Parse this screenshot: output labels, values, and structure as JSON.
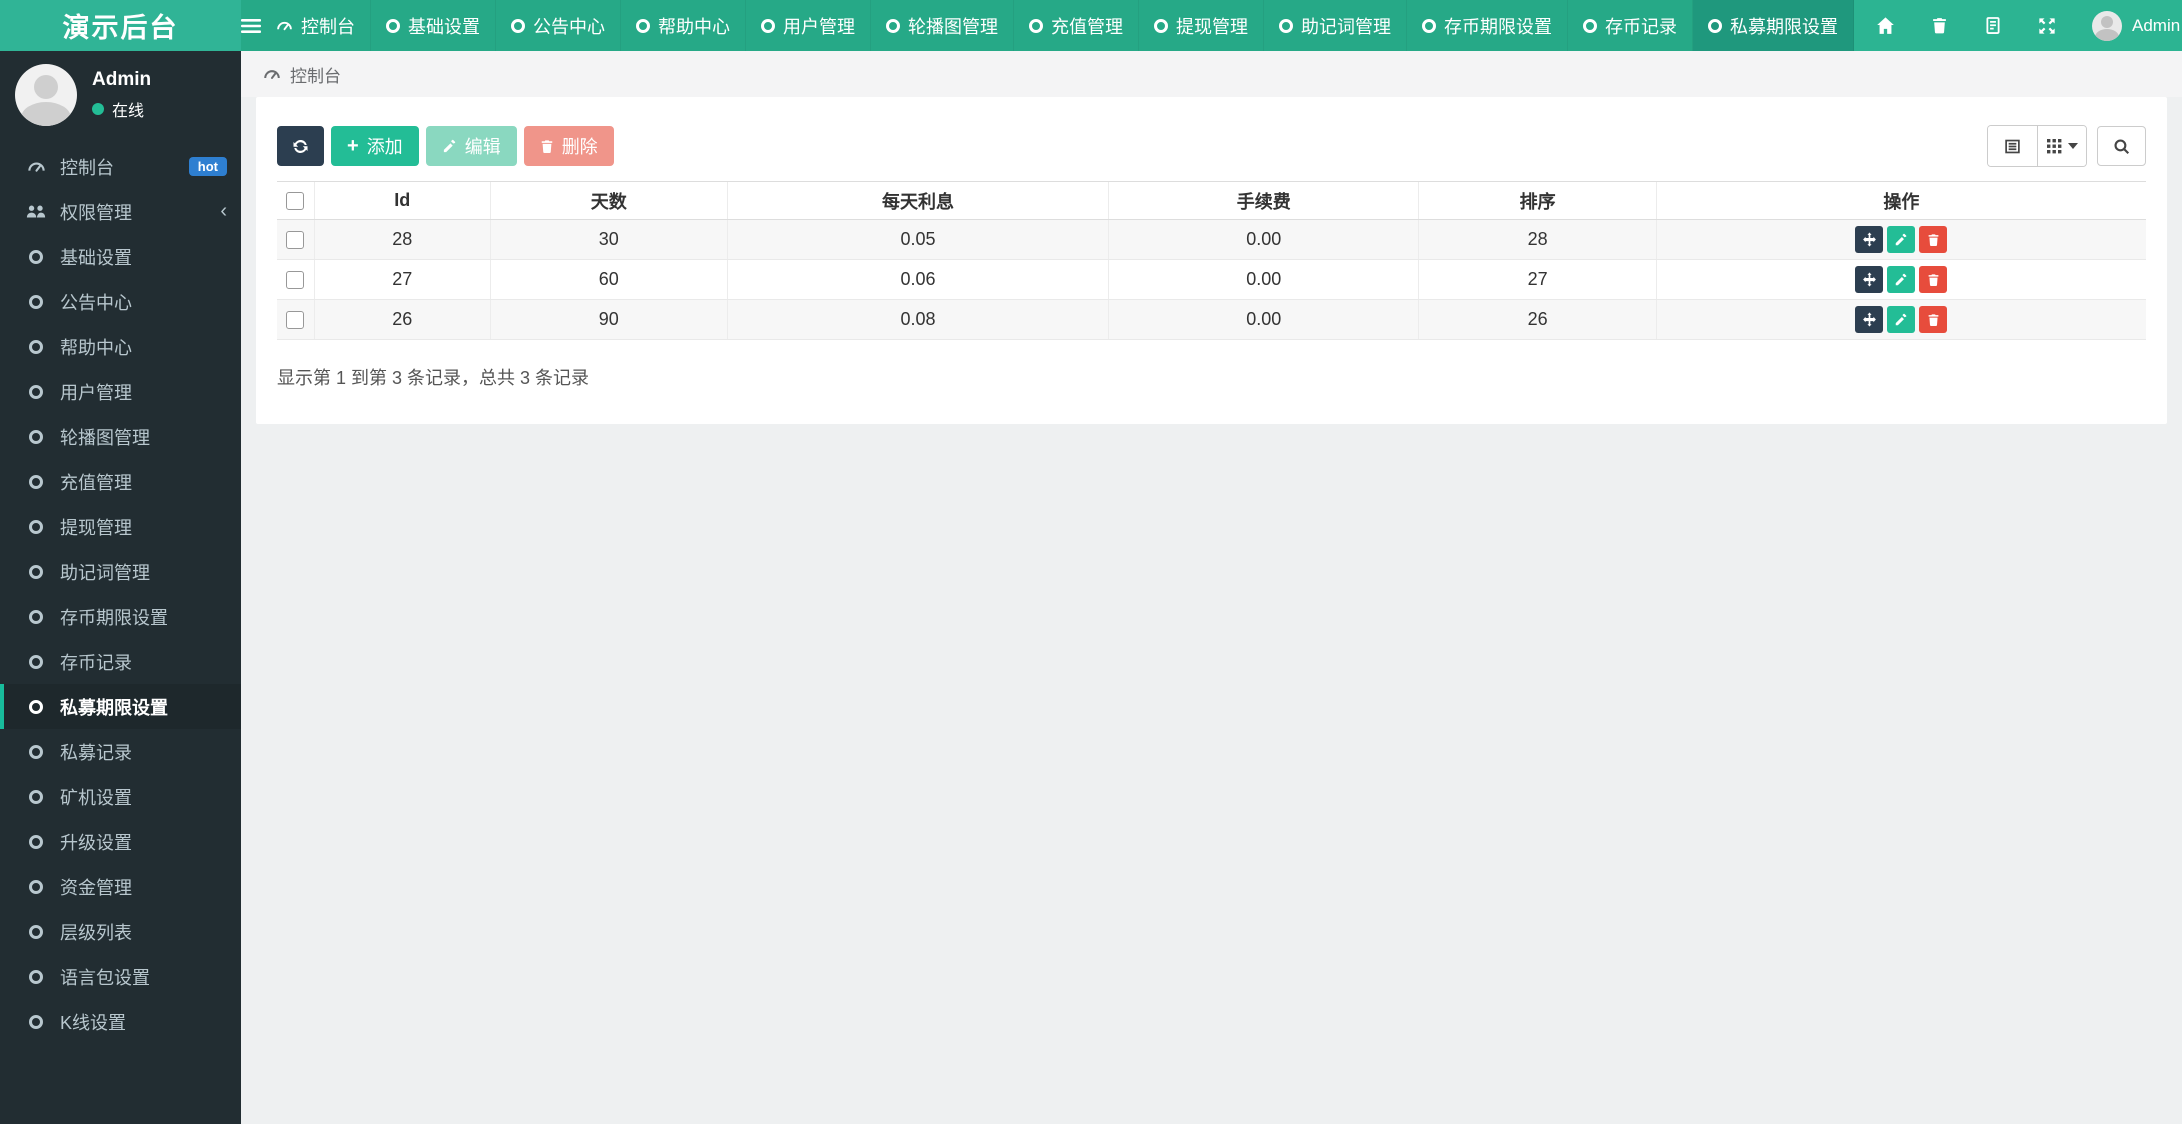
{
  "colors": {
    "brand_bg": "#30b496",
    "nav_bg": "#2cb492",
    "nav_tab_bg": "#26a987",
    "nav_tab_active_bg": "#1f987d",
    "sidebar_bg": "#222d32",
    "sidebar_text": "#b8c7ce",
    "sidebar_active_bg": "#1e282c",
    "accent": "#18bc9c",
    "primary_dark": "#2c3e50",
    "success": "#23bd96",
    "success_muted": "#8ad8c0",
    "danger": "#e74c3c",
    "danger_muted": "#f0958a",
    "hot_badge": "#2e7fd1",
    "page_bg": "#eef0f1",
    "strip_bg": "#f4f4f5",
    "card_bg": "#ffffff",
    "row_stripe": "#f7f7f7",
    "border": "#dddddd",
    "text": "#333333",
    "online_dot": "#23bd96"
  },
  "topbar": {
    "brand": "演示后台",
    "hamburger_icon": "menu-icon",
    "tabs": [
      {
        "label": "控制台",
        "icon": "gauge",
        "active": false
      },
      {
        "label": "基础设置",
        "icon": "circle",
        "active": false
      },
      {
        "label": "公告中心",
        "icon": "circle",
        "active": false
      },
      {
        "label": "帮助中心",
        "icon": "circle",
        "active": false
      },
      {
        "label": "用户管理",
        "icon": "circle",
        "active": false
      },
      {
        "label": "轮播图管理",
        "icon": "circle",
        "active": false
      },
      {
        "label": "充值管理",
        "icon": "circle",
        "active": false
      },
      {
        "label": "提现管理",
        "icon": "circle",
        "active": false
      },
      {
        "label": "助记词管理",
        "icon": "circle",
        "active": false
      },
      {
        "label": "存币期限设置",
        "icon": "circle",
        "active": false
      },
      {
        "label": "存币记录",
        "icon": "circle",
        "active": false
      },
      {
        "label": "私募期限设置",
        "icon": "circle",
        "active": true
      }
    ],
    "right_icons": [
      "home-icon",
      "trash-icon",
      "document-icon",
      "fullscreen-icon"
    ],
    "user_label": "Admin"
  },
  "sidebar": {
    "user": {
      "name": "Admin",
      "status": "在线"
    },
    "items": [
      {
        "label": "控制台",
        "icon": "gauge",
        "badge": "hot",
        "active": false
      },
      {
        "label": "权限管理",
        "icon": "users",
        "chevron": "‹",
        "active": false
      },
      {
        "label": "基础设置",
        "icon": "circle",
        "active": false
      },
      {
        "label": "公告中心",
        "icon": "circle",
        "active": false
      },
      {
        "label": "帮助中心",
        "icon": "circle",
        "active": false
      },
      {
        "label": "用户管理",
        "icon": "circle",
        "active": false
      },
      {
        "label": "轮播图管理",
        "icon": "circle",
        "active": false
      },
      {
        "label": "充值管理",
        "icon": "circle",
        "active": false
      },
      {
        "label": "提现管理",
        "icon": "circle",
        "active": false
      },
      {
        "label": "助记词管理",
        "icon": "circle",
        "active": false
      },
      {
        "label": "存币期限设置",
        "icon": "circle",
        "active": false
      },
      {
        "label": "存币记录",
        "icon": "circle",
        "active": false
      },
      {
        "label": "私募期限设置",
        "icon": "circle",
        "active": true
      },
      {
        "label": "私募记录",
        "icon": "circle",
        "active": false
      },
      {
        "label": "矿机设置",
        "icon": "circle",
        "active": false
      },
      {
        "label": "升级设置",
        "icon": "circle",
        "active": false
      },
      {
        "label": "资金管理",
        "icon": "circle",
        "active": false
      },
      {
        "label": "层级列表",
        "icon": "circle",
        "active": false
      },
      {
        "label": "语言包设置",
        "icon": "circle",
        "active": false
      },
      {
        "label": "K线设置",
        "icon": "circle",
        "active": false
      }
    ]
  },
  "breadcrumb": {
    "label": "控制台"
  },
  "toolbar": {
    "add_label": "添加",
    "edit_label": "编辑",
    "delete_label": "删除",
    "view_icons": [
      "list-view-icon",
      "columns-icon",
      "search-icon"
    ]
  },
  "table": {
    "columns": [
      "Id",
      "天数",
      "每天利息",
      "手续费",
      "排序",
      "操作"
    ],
    "rows": [
      {
        "id": "28",
        "days": "30",
        "daily_interest": "0.05",
        "fee": "0.00",
        "sort": "28"
      },
      {
        "id": "27",
        "days": "60",
        "daily_interest": "0.06",
        "fee": "0.00",
        "sort": "27"
      },
      {
        "id": "26",
        "days": "90",
        "daily_interest": "0.08",
        "fee": "0.00",
        "sort": "26"
      }
    ],
    "summary": "显示第 1 到第 3 条记录，总共 3 条记录"
  }
}
